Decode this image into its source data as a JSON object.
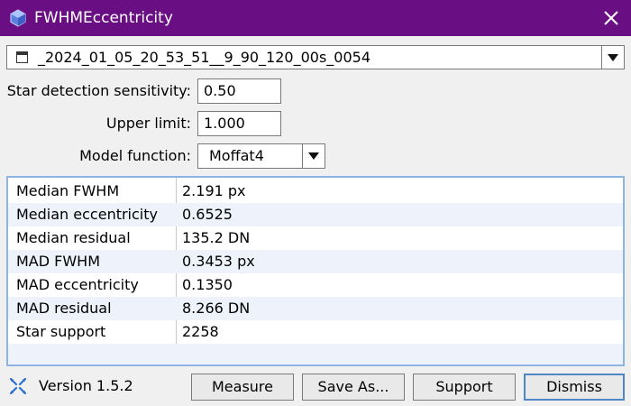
{
  "window": {
    "title": "FWHMEccentricity",
    "accent_color": "#6a0e83"
  },
  "view_selector": {
    "value": "_2024_01_05_20_53_51__9_90_120_00s_0054"
  },
  "fields": {
    "sensitivity_label": "Star detection sensitivity:",
    "sensitivity_value": "0.50",
    "upper_limit_label": "Upper limit:",
    "upper_limit_value": "1.000",
    "model_label": "Model function:",
    "model_value": "Moffat4"
  },
  "results": [
    {
      "name": "Median FWHM",
      "value": "2.191 px"
    },
    {
      "name": "Median eccentricity",
      "value": "0.6525"
    },
    {
      "name": "Median residual",
      "value": "135.2 DN"
    },
    {
      "name": "MAD FWHM",
      "value": "0.3453 px"
    },
    {
      "name": "MAD eccentricity",
      "value": "0.1350"
    },
    {
      "name": "MAD residual",
      "value": "8.266 DN"
    },
    {
      "name": "Star support",
      "value": "2258"
    }
  ],
  "footer": {
    "version": "Version 1.5.2",
    "measure": "Measure",
    "save_as": "Save As...",
    "support": "Support",
    "dismiss": "Dismiss"
  }
}
